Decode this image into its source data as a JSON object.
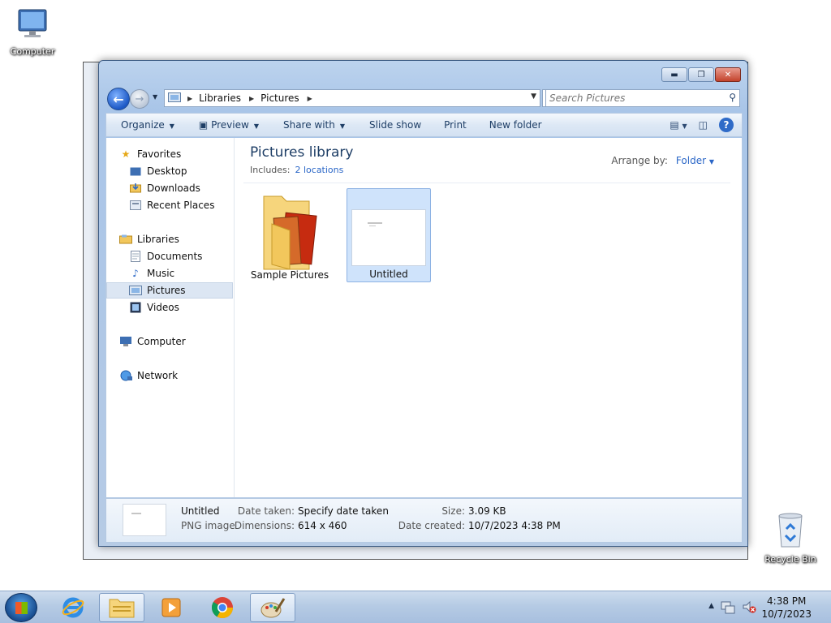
{
  "desktop": {
    "computer_icon_label": "Computer",
    "recycle_bin_label": "Recycle Bin"
  },
  "window": {
    "controls": {
      "minimize": "minimize",
      "maximize": "maximize",
      "close": "close"
    }
  },
  "nav": {
    "breadcrumbs": [
      "Libraries",
      "Pictures"
    ],
    "search_placeholder": "Search Pictures"
  },
  "toolbar": {
    "organize": "Organize",
    "preview": "Preview",
    "share_with": "Share with",
    "slide_show": "Slide show",
    "print": "Print",
    "new_folder": "New folder"
  },
  "sidebar": {
    "items": [
      {
        "label": "Favorites",
        "icon": "star-icon"
      },
      {
        "label": "Desktop",
        "icon": "desktop-icon"
      },
      {
        "label": "Downloads",
        "icon": "downloads-icon"
      },
      {
        "label": "Recent Places",
        "icon": "recent-places-icon"
      },
      {
        "label": "Libraries",
        "icon": "libraries-icon"
      },
      {
        "label": "Documents",
        "icon": "documents-icon"
      },
      {
        "label": "Music",
        "icon": "music-icon"
      },
      {
        "label": "Pictures",
        "icon": "pictures-icon"
      },
      {
        "label": "Videos",
        "icon": "videos-icon"
      },
      {
        "label": "Computer",
        "icon": "computer-icon"
      },
      {
        "label": "Network",
        "icon": "network-icon"
      }
    ],
    "selected": "Pictures"
  },
  "library": {
    "title": "Pictures library",
    "includes_label": "Includes:",
    "includes_link": "2 locations",
    "arrange_label": "Arrange by:",
    "arrange_value": "Folder"
  },
  "items": [
    {
      "name": "Sample Pictures",
      "kind": "folder"
    },
    {
      "name": "Untitled",
      "kind": "image",
      "selected": true
    }
  ],
  "details": {
    "name": "Untitled",
    "type": "PNG image",
    "date_taken_label": "Date taken:",
    "date_taken_value": "Specify date taken",
    "dimensions_label": "Dimensions:",
    "dimensions_value": "614 x 460",
    "size_label": "Size:",
    "size_value": "3.09 KB",
    "date_created_label": "Date created:",
    "date_created_value": "10/7/2023 4:38 PM"
  },
  "taskbar": {
    "time": "4:38 PM",
    "date": "10/7/2023"
  }
}
